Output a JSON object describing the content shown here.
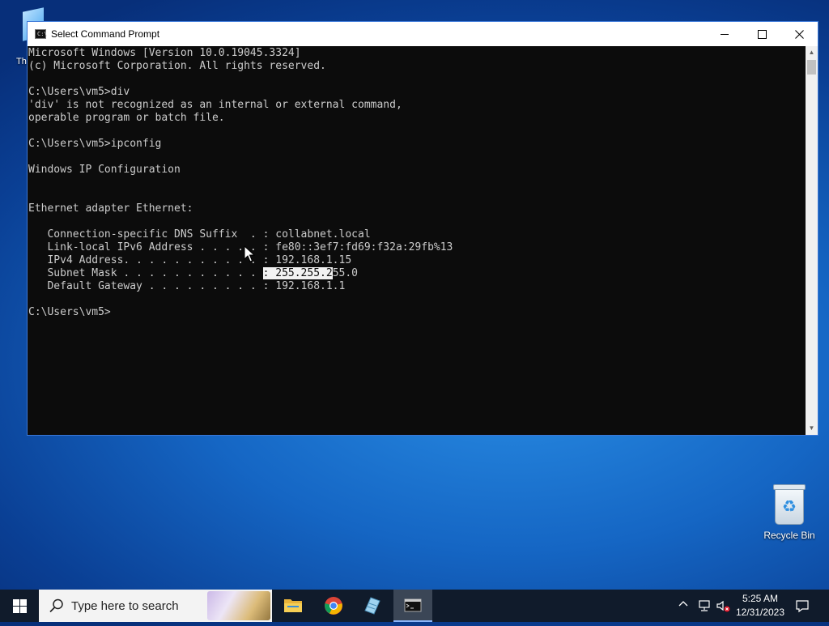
{
  "desktop": {
    "partial_icon_label": "Th",
    "recycle_bin_label": "Recycle Bin"
  },
  "window": {
    "title": "Select Command Prompt",
    "icon_text": "C:\\"
  },
  "console": {
    "lines": [
      "Microsoft Windows [Version 10.0.19045.3324]",
      "(c) Microsoft Corporation. All rights reserved.",
      "",
      "C:\\Users\\vm5>div",
      "'div' is not recognized as an internal or external command,",
      "operable program or batch file.",
      "",
      "C:\\Users\\vm5>ipconfig",
      "",
      "Windows IP Configuration",
      "",
      "",
      "Ethernet adapter Ethernet:",
      "",
      "   Connection-specific DNS Suffix  . : collabnet.local",
      "   Link-local IPv6 Address . . . . . : fe80::3ef7:fd69:f32a:29fb%13",
      "   IPv4 Address. . . . . . . . . . . : 192.168.1.15"
    ],
    "subnet_before": "   Subnet Mask . . . . . . . . . . . ",
    "subnet_selected": ": 255.255.2",
    "subnet_after": "55.0",
    "lines_after": [
      "   Default Gateway . . . . . . . . . : 192.168.1.1",
      "",
      "C:\\Users\\vm5>"
    ]
  },
  "taskbar": {
    "search_placeholder": "Type here to search",
    "time": "5:25 AM",
    "date": "12/31/2023",
    "apps": [
      "File Explorer",
      "Google Chrome",
      "Notes",
      "Command Prompt"
    ]
  },
  "colors": {
    "console_bg": "#0c0c0c",
    "console_fg": "#cccccc",
    "taskbar_bg": "#101b2b",
    "window_border": "#3b78d8"
  }
}
